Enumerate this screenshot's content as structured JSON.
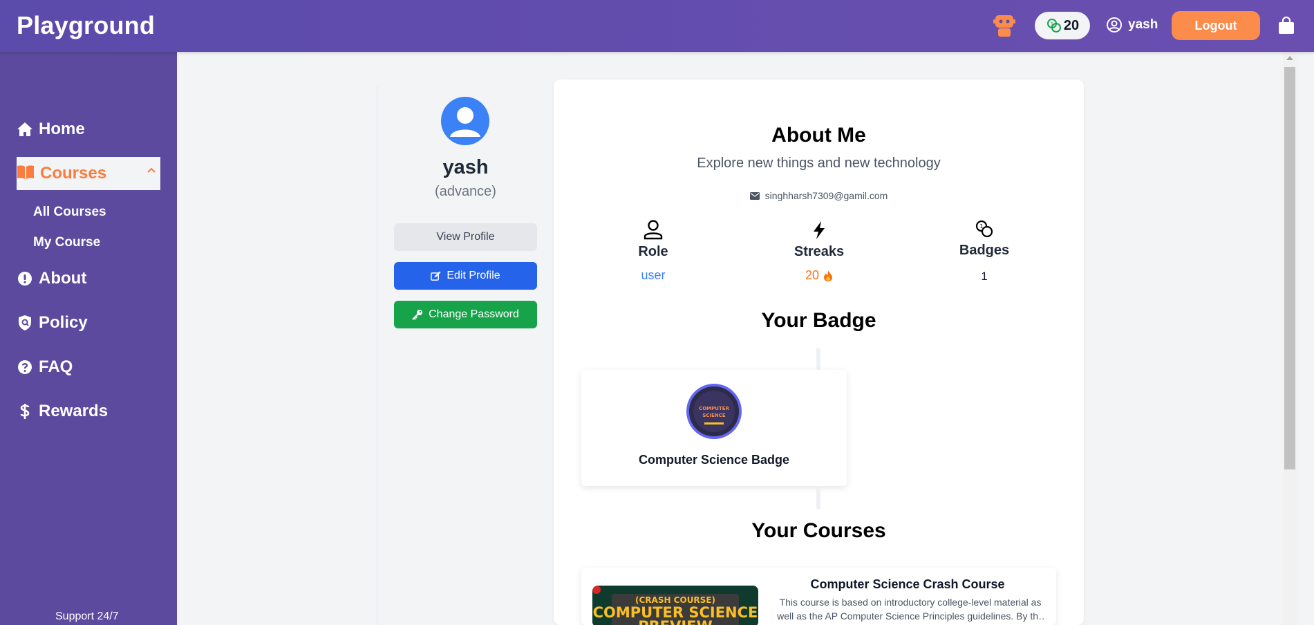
{
  "header": {
    "brand": "Playground",
    "coins": "20",
    "username": "yash",
    "logout_label": "Logout"
  },
  "sidebar": {
    "items": [
      {
        "label": "Home",
        "icon": "home-icon"
      },
      {
        "label": "Courses",
        "icon": "book-icon"
      },
      {
        "label": "About",
        "icon": "exclamation-icon"
      },
      {
        "label": "Policy",
        "icon": "shield-icon"
      },
      {
        "label": "FAQ",
        "icon": "question-icon"
      },
      {
        "label": "Rewards",
        "icon": "dollar-icon"
      }
    ],
    "sub_items": [
      {
        "label": "All Courses"
      },
      {
        "label": "My Course"
      }
    ],
    "support": "Support 24/7"
  },
  "profile": {
    "name": "yash",
    "level": "(advance)",
    "view_label": "View Profile",
    "edit_label": "Edit Profile",
    "password_label": "Change Password"
  },
  "about": {
    "title": "About Me",
    "description": "Explore new things and new technology",
    "email": "singhharsh7309@gamil.com"
  },
  "stats": {
    "role_label": "Role",
    "role_value": "user",
    "streaks_label": "Streaks",
    "streaks_value": "20",
    "badges_label": "Badges",
    "badges_value": "1"
  },
  "badge_section": {
    "title": "Your Badge",
    "badge_name": "Computer Science Badge",
    "badge_art_line1": "COMPUTER",
    "badge_art_line2": "SCIENCE"
  },
  "courses_section": {
    "title": "Your Courses",
    "course_title": "Computer Science Crash Course",
    "course_desc": "This course is based on introductory college-level material as well as the AP Computer Science Principles guidelines. By the end of this course you will understand the fundamentals.",
    "thumb_line1": "(CRASH COURSE)",
    "thumb_line2": "COMPUTER SCIENCE",
    "thumb_line3": "PREVIEW"
  },
  "colors": {
    "brand": "#5b4bab",
    "accent": "#fb8c4c",
    "primary": "#2563eb",
    "success": "#16a34a"
  }
}
